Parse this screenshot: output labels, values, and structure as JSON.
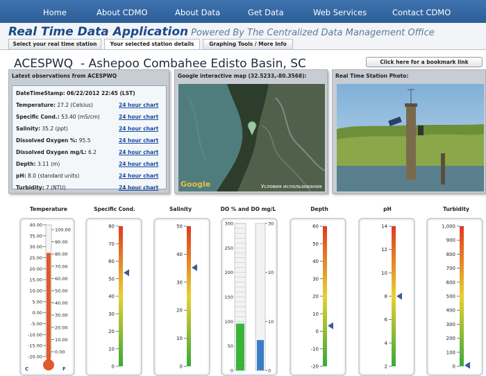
{
  "nav": {
    "items": [
      "Home",
      "About CDMO",
      "About Data",
      "Get Data",
      "Web Services",
      "Contact CDMO"
    ]
  },
  "app": {
    "title": "Real Time Data Application",
    "subtitle": "Powered By The Centralized Data Management Office"
  },
  "tabs": [
    "Select your real time station",
    "Your selected station details",
    "Graphing Tools / More Info"
  ],
  "station": {
    "code": "ACESPWQ",
    "name": "Ashepoo Combahee Edisto Basin, SC",
    "bookmark_label": "Click here for a bookmark link"
  },
  "observations": {
    "heading": "Latest observations from ACESPWQ",
    "datetime_label": "DateTimeStamp:",
    "datetime_value": "06/22/2012 22:45 (LST)",
    "chart_link": "24 hour chart",
    "rows": [
      {
        "label": "Temperature:",
        "value": "27.2 (Celsius)"
      },
      {
        "label": "Specific Cond.:",
        "value": "53.40 (mS/cm)"
      },
      {
        "label": "Salinity:",
        "value": "35.2 (ppt)"
      },
      {
        "label": "Dissolved Oxygen %:",
        "value": "95.5"
      },
      {
        "label": "Dissolved Oxygen mg/L:",
        "value": "6.2"
      },
      {
        "label": "Depth:",
        "value": "3.11 (m)"
      },
      {
        "label": "pH:",
        "value": "8.0 (standard units)"
      },
      {
        "label": "Turbidity:",
        "value": "7 (NTU)"
      }
    ]
  },
  "map": {
    "heading": "Google interactive map (32.5233,-80.3568):",
    "logo": "Google",
    "terms": "Условия использования"
  },
  "photo": {
    "heading": "Real Time Station Photo:"
  },
  "gauges": {
    "temperature": {
      "label": "Temperature",
      "celsius_ticks": [
        "40.00",
        "35.00",
        "30.00",
        "25.00",
        "20.00",
        "15.00",
        "10.00",
        "5.00",
        "0.00",
        "-5.00",
        "-10.00",
        "-15.00",
        "-20.00"
      ],
      "fahrenheit_ticks": [
        "100.00",
        "90.00",
        "80.00",
        "70.00",
        "60.00",
        "50.00",
        "40.00",
        "30.00",
        "20.00",
        "10.00",
        "0.00"
      ],
      "unit_c": "C",
      "unit_f": "F",
      "value": 27.2,
      "min": -20,
      "max": 40
    },
    "specific_cond": {
      "label": "Specific Cond.",
      "ticks": [
        "80",
        "70",
        "60",
        "50",
        "40",
        "30",
        "20",
        "10",
        "0"
      ],
      "min": 0,
      "max": 80,
      "value": 53.4
    },
    "salinity": {
      "label": "Salinity",
      "ticks": [
        "50",
        "40",
        "30",
        "20",
        "10",
        "0"
      ],
      "min": 0,
      "max": 50,
      "value": 35.2
    },
    "do": {
      "label": "DO % and DO mg/L",
      "pct_ticks": [
        "300",
        "250",
        "200",
        "150",
        "100",
        "50",
        "0"
      ],
      "mgl_ticks": [
        "30",
        "20",
        "10",
        "0"
      ],
      "pct_value": 95.5,
      "pct_max": 300,
      "mgl_value": 6.2,
      "mgl_max": 30,
      "pct_color": "#3cb43c",
      "mgl_color": "#3a7ec8"
    },
    "depth": {
      "label": "Depth",
      "ticks": [
        "60",
        "50",
        "40",
        "30",
        "20",
        "10",
        "0",
        "-10",
        "-20"
      ],
      "min": -20,
      "max": 60,
      "value": 3.11
    },
    "ph": {
      "label": "pH",
      "ticks": [
        "14",
        "12",
        "10",
        "8",
        "6",
        "4",
        "2"
      ],
      "min": 2,
      "max": 14,
      "value": 8.0
    },
    "turbidity": {
      "label": "Turbidity",
      "ticks": [
        "1,000",
        "900",
        "800",
        "700",
        "600",
        "500",
        "400",
        "300",
        "200",
        "100",
        "0"
      ],
      "min": 0,
      "max": 1000,
      "value": 7
    }
  },
  "colors": {
    "nav_bg": "#2c5d97",
    "title": "#1a4a8a",
    "link": "#1a4aa0",
    "pointer": "#3a5a9a",
    "thermometer_red": "#e05a2a"
  }
}
